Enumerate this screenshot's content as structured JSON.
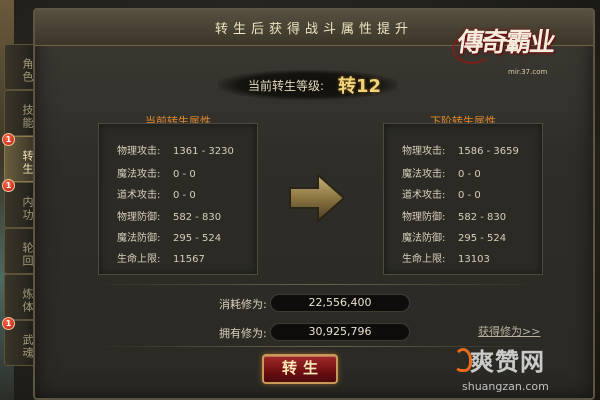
{
  "panel": {
    "title": "转生后获得战斗属性提升"
  },
  "logo": {
    "text": "傳奇霸业",
    "url": "mir.37.com"
  },
  "level": {
    "label": "当前转生等级:",
    "value": "转12"
  },
  "sidebar": {
    "tabs": [
      {
        "label": "角色",
        "badge": "",
        "active": false
      },
      {
        "label": "技能",
        "badge": "",
        "active": false
      },
      {
        "label": "转生",
        "badge": "1",
        "active": true
      },
      {
        "label": "内功",
        "badge": "1",
        "active": false
      },
      {
        "label": "轮回",
        "badge": "",
        "active": false
      },
      {
        "label": "炼体",
        "badge": "",
        "active": false
      },
      {
        "label": "武魂",
        "badge": "1",
        "active": false
      }
    ]
  },
  "current": {
    "heading": "当前转生属性",
    "rows": [
      {
        "key": "物理攻击:",
        "value": "1361 - 3230"
      },
      {
        "key": "魔法攻击:",
        "value": "0 - 0"
      },
      {
        "key": "道术攻击:",
        "value": "0 - 0"
      },
      {
        "key": "物理防御:",
        "value": "582 - 830"
      },
      {
        "key": "魔法防御:",
        "value": "295 - 524"
      },
      {
        "key": "生命上限:",
        "value": "11567"
      }
    ]
  },
  "next": {
    "heading": "下阶转生属性",
    "rows": [
      {
        "key": "物理攻击:",
        "value": "1586 - 3659"
      },
      {
        "key": "魔法攻击:",
        "value": "0 - 0"
      },
      {
        "key": "道术攻击:",
        "value": "0 - 0"
      },
      {
        "key": "物理防御:",
        "value": "582 - 830"
      },
      {
        "key": "魔法防御:",
        "value": "295 - 524"
      },
      {
        "key": "生命上限:",
        "value": "13103"
      }
    ]
  },
  "cost": {
    "label": "消耗修为:",
    "value": "22,556,400"
  },
  "have": {
    "label": "拥有修为:",
    "value": "30,925,796"
  },
  "earn_link": "获得修为>>",
  "action_button": "转生",
  "watermark": {
    "cn": "爽赞网",
    "en": "shuangzan.com"
  },
  "colors": {
    "accent": "#e38a2e",
    "level": "#f3d37a",
    "button": "#8e1b1d"
  },
  "icons": {
    "arrow": "right-arrow-icon",
    "badge": "notification-badge-icon"
  }
}
